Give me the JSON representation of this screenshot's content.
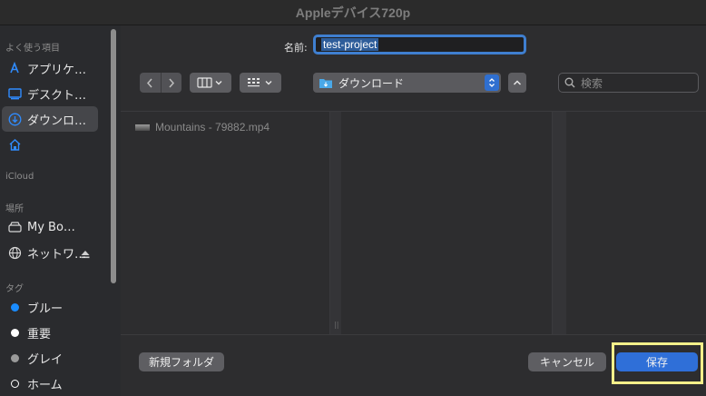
{
  "window": {
    "title": "Appleデバイス720p"
  },
  "sidebar": {
    "favorites_header": "よく使う項目",
    "favorites": [
      {
        "label": "アプリケ…",
        "icon": "applications-icon"
      },
      {
        "label": "デスクト…",
        "icon": "desktop-icon"
      },
      {
        "label": "ダウンロ…",
        "icon": "downloads-icon",
        "selected": true
      },
      {
        "label": "",
        "icon": "home-icon"
      }
    ],
    "icloud_header": "iCloud",
    "locations_header": "場所",
    "locations": [
      {
        "label": "My Bo…",
        "icon": "drive-icon"
      },
      {
        "label": "ネットワ…",
        "icon": "network-icon"
      }
    ],
    "tags_header": "タグ",
    "tags": [
      {
        "label": "ブルー",
        "color": "#1a8cff"
      },
      {
        "label": "重要",
        "color": "#ffffff"
      },
      {
        "label": "グレイ",
        "color": "#9a9a9a"
      },
      {
        "label": "ホーム",
        "color": "#ffffff"
      }
    ]
  },
  "save": {
    "name_label": "名前:",
    "filename": "test-project"
  },
  "toolbar": {
    "location": "ダウンロード",
    "search_placeholder": "検索"
  },
  "browser": {
    "files": [
      "Mountains - 79882.mp4"
    ]
  },
  "buttons": {
    "new_folder": "新規フォルダ",
    "cancel": "キャンセル",
    "save": "保存"
  },
  "colors": {
    "accent": "#2f6fd8",
    "highlight": "#f3f08a"
  }
}
